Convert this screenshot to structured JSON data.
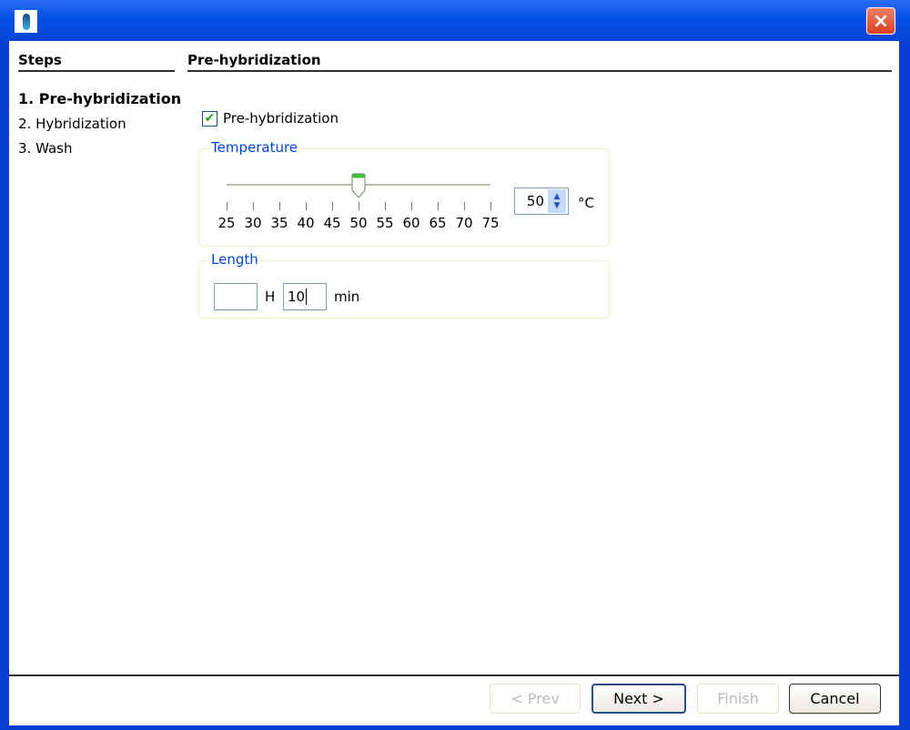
{
  "window": {
    "title": "",
    "close_label": "×"
  },
  "steps": {
    "title": "Steps",
    "items": [
      {
        "label": "1. Pre-hybridization",
        "active": true
      },
      {
        "label": "2. Hybridization",
        "active": false
      },
      {
        "label": "3. Wash",
        "active": false
      }
    ]
  },
  "page": {
    "title": "Pre-hybridization",
    "checkbox_label": "Pre-hybridization",
    "checkbox_checked": true,
    "temperature": {
      "label": "Temperature",
      "min": 25,
      "max": 75,
      "value": 50,
      "ticks": [
        "25",
        "30",
        "35",
        "40",
        "45",
        "50",
        "55",
        "60",
        "65",
        "70",
        "75"
      ],
      "spin_value": "50",
      "unit": "°C"
    },
    "length": {
      "label": "Length",
      "hours_value": "",
      "hours_unit": "H",
      "minutes_value": "10",
      "minutes_unit": "min"
    }
  },
  "buttons": {
    "prev": "< Prev",
    "next": "Next >",
    "finish": "Finish",
    "cancel": "Cancel"
  }
}
